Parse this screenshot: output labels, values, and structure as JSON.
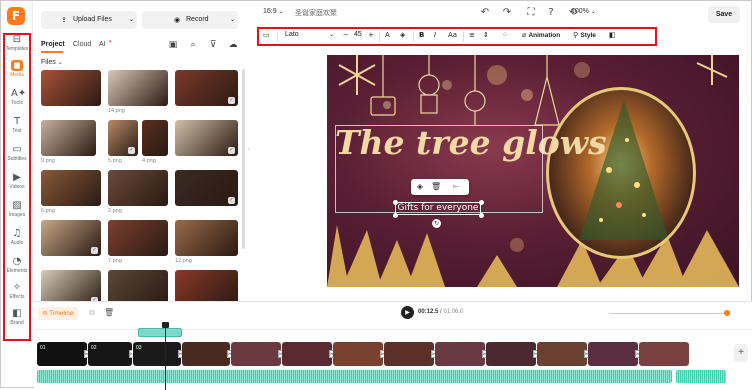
{
  "app": {
    "logo_letter": "F"
  },
  "rail": {
    "items": [
      {
        "label": "Templates",
        "icon": "⊟"
      },
      {
        "label": "Media",
        "icon": "▆"
      },
      {
        "label": "Tools",
        "icon": "A✦"
      },
      {
        "label": "Text",
        "icon": "T"
      },
      {
        "label": "Subtitles",
        "icon": "▭"
      },
      {
        "label": "Videos",
        "icon": "▶"
      },
      {
        "label": "Images",
        "icon": "▨"
      },
      {
        "label": "Audio",
        "icon": "♫"
      },
      {
        "label": "Elements",
        "icon": "◔"
      },
      {
        "label": "Effects",
        "icon": "✧"
      },
      {
        "label": "Brand",
        "icon": "◧"
      }
    ]
  },
  "panel": {
    "upload_label": "Upload Files",
    "record_label": "Record",
    "tabs": {
      "project": "Project",
      "cloud": "Cloud",
      "ai": "AI"
    },
    "files_label": "Files",
    "thumbs": [
      {
        "caption": "",
        "checked": false
      },
      {
        "caption": "14.png",
        "checked": false
      },
      {
        "caption": "",
        "checked": true
      },
      {
        "caption": "9.png",
        "checked": false
      },
      {
        "caption": "5.png",
        "checked": true
      },
      {
        "caption": "4.png",
        "checked": false
      },
      {
        "caption": "",
        "checked": true
      },
      {
        "caption": "6.png",
        "checked": false
      },
      {
        "caption": "2.png",
        "checked": false
      },
      {
        "caption": "",
        "checked": true
      },
      {
        "caption": "",
        "checked": true
      },
      {
        "caption": "7.png",
        "checked": false
      },
      {
        "caption": "12.png",
        "checked": false
      },
      {
        "caption": "",
        "checked": true
      },
      {
        "caption": "",
        "checked": false
      },
      {
        "caption": "3.png",
        "checked": false
      },
      {
        "caption": "",
        "checked": false
      },
      {
        "caption": "",
        "checked": false
      },
      {
        "caption": "",
        "checked": false
      }
    ]
  },
  "topbar": {
    "ratio": "16:9",
    "project_name": "圣诞家庭欢聚",
    "zoom": "100%",
    "save_label": "Save"
  },
  "toolbar": {
    "font": "Lato",
    "font_size": "45",
    "animation_label": "Animation",
    "style_label": "Style"
  },
  "canvas": {
    "headline": "The tree glows",
    "subtitle": "Gifts for everyone"
  },
  "timeline": {
    "label": "Timeline",
    "current_time": "00:12.5",
    "total_time": "01:06.0",
    "clips": [
      "01",
      "02",
      "03",
      "",
      "",
      "",
      "",
      "",
      "",
      "",
      "",
      "",
      ""
    ]
  },
  "colors": {
    "accent": "#ff7a1a",
    "highlight_box": "#e5121c"
  }
}
